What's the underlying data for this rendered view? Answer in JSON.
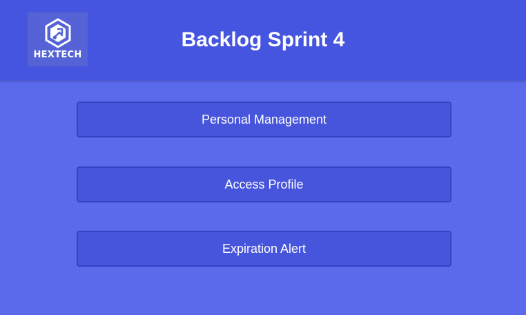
{
  "header": {
    "title": "Backlog Sprint 4",
    "logo": {
      "text": "HEXTECH",
      "icon": "hexagon-tools-icon"
    }
  },
  "menu": {
    "items": [
      {
        "label": "Personal Management"
      },
      {
        "label": "Access Profile"
      },
      {
        "label": "Expiration Alert"
      }
    ]
  },
  "colors": {
    "background": "#5b6aea",
    "header": "#4655e0",
    "button": "#4755dc",
    "button_border": "#3443c6",
    "text": "#ffffff"
  }
}
